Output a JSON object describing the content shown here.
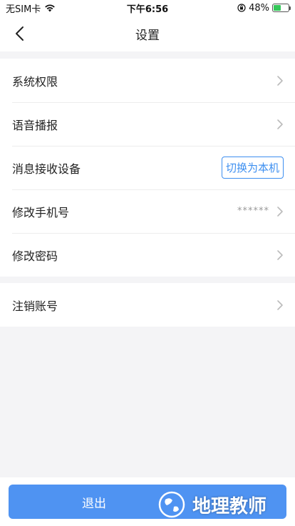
{
  "status_bar": {
    "carrier": "无SIM卡",
    "time": "下午6:56",
    "battery": "48%",
    "battery_level": 0.48
  },
  "nav": {
    "title": "设置"
  },
  "settings": {
    "group1": [
      {
        "label": "系统权限"
      },
      {
        "label": "语音播报"
      },
      {
        "label": "消息接收设备",
        "action": "切换为本机"
      },
      {
        "label": "修改手机号",
        "value": "******"
      },
      {
        "label": "修改密码"
      }
    ],
    "group2": [
      {
        "label": "注销账号"
      }
    ]
  },
  "logout": {
    "label": "退出"
  },
  "watermark": {
    "text": "地理教师"
  },
  "colors": {
    "accent": "#4f93f2",
    "link": "#3d8ff0",
    "background": "#f4f4f6"
  }
}
